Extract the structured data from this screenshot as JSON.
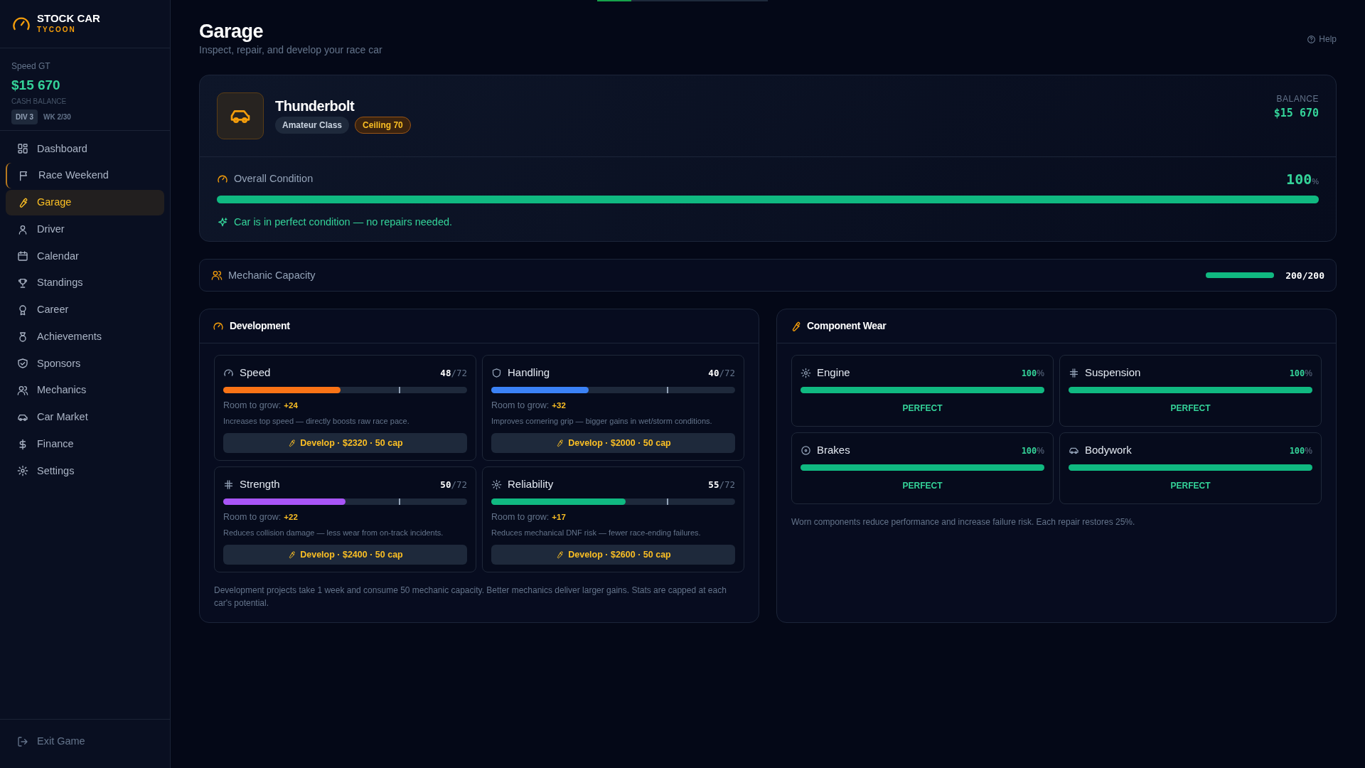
{
  "top_progress": {
    "level": 0.2
  },
  "brand": {
    "title": "STOCK CAR",
    "subtitle": "TYCOON"
  },
  "team": {
    "name": "Speed GT",
    "cash": "$15 670",
    "cash_label": "CASH BALANCE",
    "division": "DIV 3",
    "week": "WK 2/30"
  },
  "nav": [
    {
      "label": "Dashboard",
      "selected": false,
      "flagged": false
    },
    {
      "label": "Race Weekend",
      "selected": false,
      "flagged": true
    },
    {
      "label": "Garage",
      "selected": true,
      "flagged": false
    },
    {
      "label": "Driver",
      "selected": false,
      "flagged": false
    },
    {
      "label": "Calendar",
      "selected": false,
      "flagged": false
    },
    {
      "label": "Standings",
      "selected": false,
      "flagged": false
    },
    {
      "label": "Career",
      "selected": false,
      "flagged": false
    },
    {
      "label": "Achievements",
      "selected": false,
      "flagged": false
    },
    {
      "label": "Sponsors",
      "selected": false,
      "flagged": false
    },
    {
      "label": "Mechanics",
      "selected": false,
      "flagged": false
    },
    {
      "label": "Car Market",
      "selected": false,
      "flagged": false
    },
    {
      "label": "Finance",
      "selected": false,
      "flagged": false
    },
    {
      "label": "Settings",
      "selected": false,
      "flagged": false
    }
  ],
  "exit": "Exit Game",
  "page": {
    "title": "Garage",
    "subtitle": "Inspect, repair, and develop your race car",
    "help": "Help"
  },
  "car": {
    "name": "Thunderbolt",
    "class_badge": "Amateur Class",
    "ceiling_badge": "Ceiling 70",
    "balance_label": "BALANCE",
    "balance": "$15 670",
    "condition_label": "Overall Condition",
    "condition_value": "100",
    "condition_unit": "%",
    "condition": {
      "level": 1
    },
    "condition_note": "Car is in perfect condition — no repairs needed."
  },
  "mechanic_capacity": {
    "label": "Mechanic Capacity",
    "level": 1,
    "reading": "200/200"
  },
  "development": {
    "title": "Development",
    "stats": [
      {
        "name": "Speed",
        "value": "48",
        "max": "/72",
        "color": "#f97316",
        "level": 0.48,
        "cap_marker": {
          "level": 0.72
        },
        "grow_label": "Room to grow:",
        "grow": "+24",
        "description": "Increases top speed — directly boosts raw race pace.",
        "button": "Develop · $2320 · 50 cap"
      },
      {
        "name": "Handling",
        "value": "40",
        "max": "/72",
        "color": "#3b82f6",
        "level": 0.4,
        "cap_marker": {
          "level": 0.72
        },
        "grow_label": "Room to grow:",
        "grow": "+32",
        "description": "Improves cornering grip — bigger gains in wet/storm conditions.",
        "button": "Develop · $2000 · 50 cap"
      },
      {
        "name": "Strength",
        "value": "50",
        "max": "/72",
        "color": "#a855f7",
        "level": 0.5,
        "cap_marker": {
          "level": 0.72
        },
        "grow_label": "Room to grow:",
        "grow": "+22",
        "description": "Reduces collision damage — less wear from on-track incidents.",
        "button": "Develop · $2400 · 50 cap"
      },
      {
        "name": "Reliability",
        "value": "55",
        "max": "/72",
        "color": "#10b981",
        "level": 0.55,
        "cap_marker": {
          "level": 0.72
        },
        "grow_label": "Room to grow:",
        "grow": "+17",
        "description": "Reduces mechanical DNF risk — fewer race-ending failures.",
        "button": "Develop · $2600 · 50 cap"
      }
    ],
    "footnote": "Development projects take 1 week and consume 50 mechanic capacity. Better mechanics deliver larger gains. Stats are capped at each car's potential."
  },
  "component_wear": {
    "title": "Component Wear",
    "components": [
      {
        "name": "Engine",
        "value": "100",
        "unit": "%",
        "level": 1,
        "status": "PERFECT"
      },
      {
        "name": "Suspension",
        "value": "100",
        "unit": "%",
        "level": 1,
        "status": "PERFECT"
      },
      {
        "name": "Brakes",
        "value": "100",
        "unit": "%",
        "level": 1,
        "status": "PERFECT"
      },
      {
        "name": "Bodywork",
        "value": "100",
        "unit": "%",
        "level": 1,
        "status": "PERFECT"
      }
    ],
    "footnote": "Worn components reduce performance and increase failure risk. Each repair restores 25%."
  }
}
